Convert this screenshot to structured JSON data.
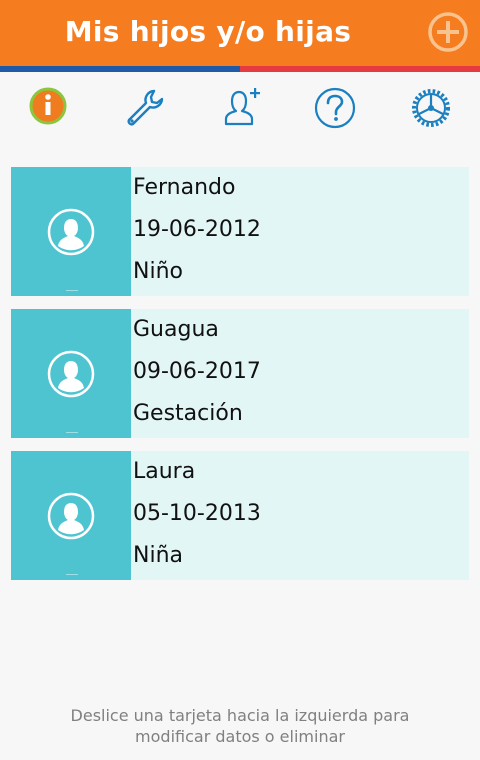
{
  "header": {
    "title": "Mis hijos y/o hijas",
    "add_icon": "plus-circle-icon",
    "bg_color": "#f57c1f"
  },
  "stripe": {
    "left_color": "#1f5aa8",
    "right_color": "#e53a3f"
  },
  "toolbar": {
    "items": [
      {
        "icon": "info-icon"
      },
      {
        "icon": "wrench-icon"
      },
      {
        "icon": "add-user-icon"
      },
      {
        "icon": "help-icon"
      },
      {
        "icon": "settings-wheel-icon"
      }
    ],
    "accent_color": "#1b7fc0"
  },
  "children": [
    {
      "name": "Fernando",
      "date": "19-06-2012",
      "status": "Niño"
    },
    {
      "name": "Guagua",
      "date": "09-06-2017",
      "status": "Gestación"
    },
    {
      "name": "Laura",
      "date": "05-10-2013",
      "status": "Niña"
    }
  ],
  "card_colors": {
    "photo_bg": "#4ec4d0",
    "card_bg": "#e3f6f6"
  },
  "footer": {
    "line1": "Deslice una tarjeta hacia la izquierda para",
    "line2": "modificar datos o eliminar"
  }
}
